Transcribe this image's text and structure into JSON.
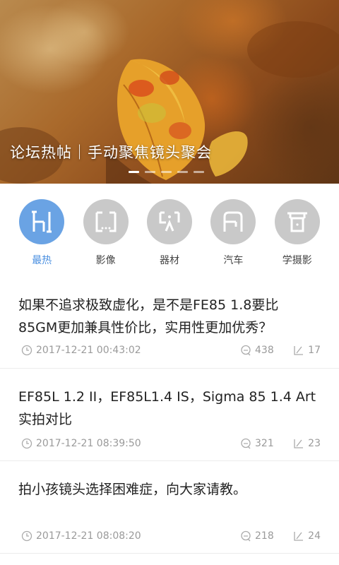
{
  "banner": {
    "title": "论坛热帖｜手动聚焦镜头聚会",
    "dot_count": 5,
    "active_dot": 0
  },
  "categories": [
    {
      "label": "最热",
      "icon": "hot-icon",
      "active": true
    },
    {
      "label": "影像",
      "icon": "image-icon",
      "active": false
    },
    {
      "label": "器材",
      "icon": "equipment-icon",
      "active": false
    },
    {
      "label": "汽车",
      "icon": "car-icon",
      "active": false
    },
    {
      "label": "学摄影",
      "icon": "learn-photo-icon",
      "active": false
    }
  ],
  "posts": [
    {
      "title_lines": [
        "如果不追求极致虚化，是不是FE85 1.8要比",
        "85GM更加兼具性价比，实用性更加优秀？"
      ],
      "time": "2017-12-21 00:43:02",
      "comments": "438",
      "views": "17"
    },
    {
      "title_lines": [
        "EF85L 1.2 II，EF85L1.4 IS，Sigma 85 1.4 Art",
        "实拍对比"
      ],
      "time": "2017-12-21 08:39:50",
      "comments": "321",
      "views": "23"
    },
    {
      "title_lines": [
        "拍小孩镜头选择困难症，向大家请教。"
      ],
      "time": "2017-12-21 08:08:20",
      "comments": "218",
      "views": "24"
    }
  ],
  "colors": {
    "accent": "#6aa3e4",
    "accent_text": "#4a8fe0",
    "inactive_circle": "#c9c9c9",
    "meta_text": "#9a9a9a"
  }
}
